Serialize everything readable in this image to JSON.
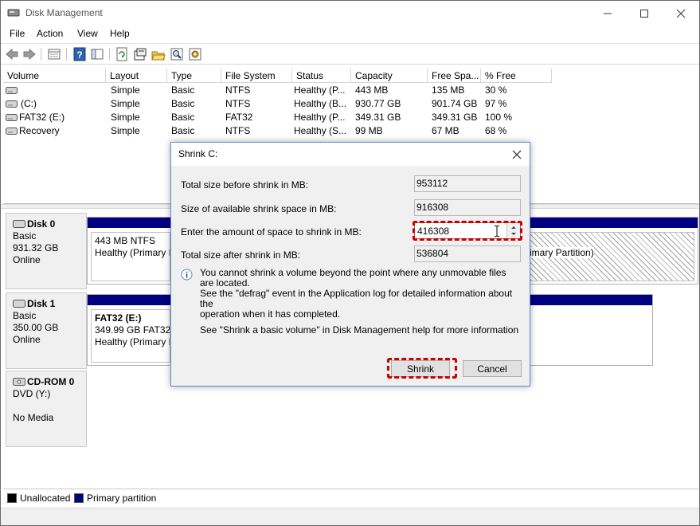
{
  "window": {
    "title": "Disk Management"
  },
  "menu": [
    "File",
    "Action",
    "View",
    "Help"
  ],
  "toolbar_icons": [
    "back-arrow-icon",
    "forward-arrow-icon",
    "properties-icon",
    "help-icon",
    "console-icon",
    "refresh-icon",
    "rescan-icon",
    "open-icon",
    "search-icon",
    "settings-icon"
  ],
  "volumes": {
    "columns": [
      "Volume",
      "Layout",
      "Type",
      "File System",
      "Status",
      "Capacity",
      "Free Spa...",
      "% Free"
    ],
    "rows": [
      {
        "volume": "",
        "layout": "Simple",
        "type": "Basic",
        "fs": "NTFS",
        "status": "Healthy (P...",
        "capacity": "443 MB",
        "free": "135 MB",
        "pct": "30 %"
      },
      {
        "volume": "(C:)",
        "layout": "Simple",
        "type": "Basic",
        "fs": "NTFS",
        "status": "Healthy (B...",
        "capacity": "930.77 GB",
        "free": "901.74 GB",
        "pct": "97 %"
      },
      {
        "volume": "FAT32 (E:)",
        "layout": "Simple",
        "type": "Basic",
        "fs": "FAT32",
        "status": "Healthy (P...",
        "capacity": "349.31 GB",
        "free": "349.31 GB",
        "pct": "100 %"
      },
      {
        "volume": "Recovery",
        "layout": "Simple",
        "type": "Basic",
        "fs": "NTFS",
        "status": "Healthy (S...",
        "capacity": "99 MB",
        "free": "67 MB",
        "pct": "68 %"
      }
    ]
  },
  "disks": [
    {
      "name": "Disk 0",
      "kind": "Basic",
      "size": "931.32 GB",
      "state": "Online",
      "part1": {
        "line1": "443 MB NTFS",
        "line2": "Healthy (Primary P"
      },
      "part_right": "imary Partition)"
    },
    {
      "name": "Disk 1",
      "kind": "Basic",
      "size": "350.00 GB",
      "state": "Online",
      "part1": {
        "line1": "FAT32  (E:)",
        "line2": "349.99 GB FAT32",
        "line3": "Healthy (Primary P"
      }
    },
    {
      "name": "CD-ROM 0",
      "kind": "DVD (Y:)",
      "state": "No Media"
    }
  ],
  "legend": [
    {
      "label": "Unallocated",
      "color": "#000000"
    },
    {
      "label": "Primary partition",
      "color": "#000080"
    }
  ],
  "dialog": {
    "title": "Shrink C:",
    "total_before_label": "Total size before shrink in MB:",
    "total_before_value": "953112",
    "available_label": "Size of available shrink space in MB:",
    "available_value": "916308",
    "amount_label": "Enter the amount of space to shrink in MB:",
    "amount_value": "416308",
    "total_after_label": "Total size after shrink in MB:",
    "total_after_value": "536804",
    "info_line1": "You cannot shrink a volume beyond the point where any unmovable files are located.",
    "info_line2": "See the \"defrag\" event in the Application log for detailed information about the",
    "info_line3": "operation when it has completed.",
    "help_text": "See \"Shrink a basic volume\" in Disk Management help for more information",
    "shrink_label": "Shrink",
    "cancel_label": "Cancel"
  },
  "colors": {
    "primary_partition": "#000080",
    "highlight": "#cc0000",
    "dialog_border": "#5a8dd6"
  }
}
